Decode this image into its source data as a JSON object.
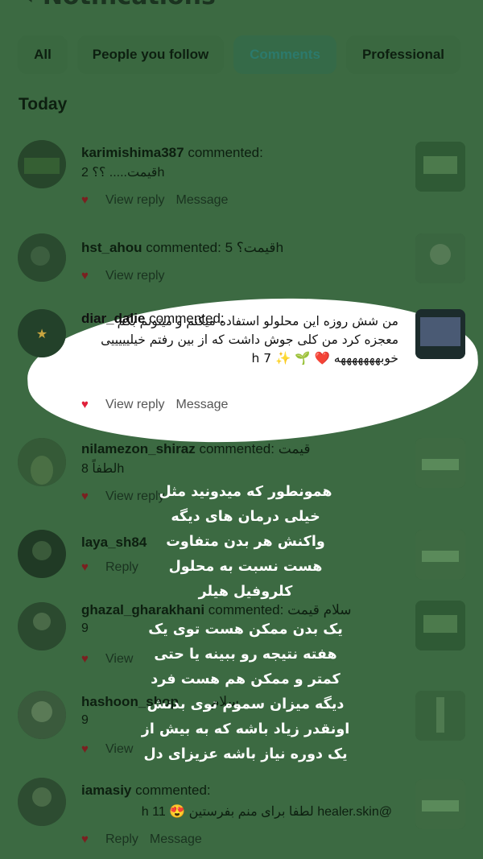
{
  "header": {
    "title": "Notifications"
  },
  "tabs": [
    "All",
    "People you follow",
    "Comments",
    "Professional"
  ],
  "section_title": "Today",
  "colors": {
    "background": "#3c6a42",
    "heart": "#7a2020",
    "highlight_heart": "#e0203a",
    "overlay_text": "#ffffff"
  },
  "notifications": [
    {
      "user": "karimishima387",
      "action": " commented:",
      "comment": "قیمت..... ؟؟",
      "meta": "2 ",
      "time": "h",
      "reply": "View reply",
      "message": "Message"
    },
    {
      "user": "hst_ahou",
      "action": " commented: ",
      "comment": "قیمت؟",
      "meta": "5 ",
      "time": "h",
      "reply": "View reply",
      "message": ""
    },
    {
      "user": "diar_dalie",
      "action": " commented:",
      "comment": "من شش روزه این محلولو استفاده میکنم و میتونم بگم معجزه کرد من کلی جوش داشت که از بین رفتم خیلیییییی خوبهههههههه ❤️ 🌱 ✨",
      "meta": "7 ",
      "time": "h",
      "reply": "View reply",
      "message": "Message"
    },
    {
      "user": "nilamezon_shiraz",
      "action": " commented: ",
      "comment": "قیمت",
      "comment2": "لطفاً",
      "meta": "8 ",
      "time": "h",
      "reply": "View reply",
      "message": ""
    },
    {
      "user": "laya_sh84",
      "action": "",
      "comment": "",
      "meta": "",
      "time": "",
      "reply": "Reply",
      "message": ""
    },
    {
      "user": "ghazal_gharakhani",
      "action": " commented: ",
      "comment": "سلام قیمت",
      "meta": "9 ",
      "time": "",
      "reply": "View",
      "message": ""
    },
    {
      "user": "hashoon_shop",
      "action": "",
      "comment": "سلام",
      "meta": "9 ",
      "time": "",
      "reply": "View",
      "message": ""
    },
    {
      "user": "iamasiy",
      "action": " commented: ",
      "comment": "@healer.skin لطفا برای منم بفرستین 😍",
      "meta": "11 ",
      "time": "h",
      "reply": "Reply",
      "message": "Message"
    }
  ],
  "overlay": {
    "para1": [
      "همونطور که میدونید مثل",
      "خیلی درمان های دیگه",
      "واکنش هر بدن متفاوت",
      "هست نسبت به محلول",
      "کلروفیل هیلر"
    ],
    "para2": [
      "یک بدن ممکن هست توی یک",
      "هفته نتیجه رو ببینه یا حتی",
      "کمتر و ممکن هم هست  فرد",
      "دیگه میزان سموم توی بدنش",
      "اونقدر زیاد باشه که به بیش از",
      "یک دوره نیاز باشه عزیزای دل"
    ]
  }
}
